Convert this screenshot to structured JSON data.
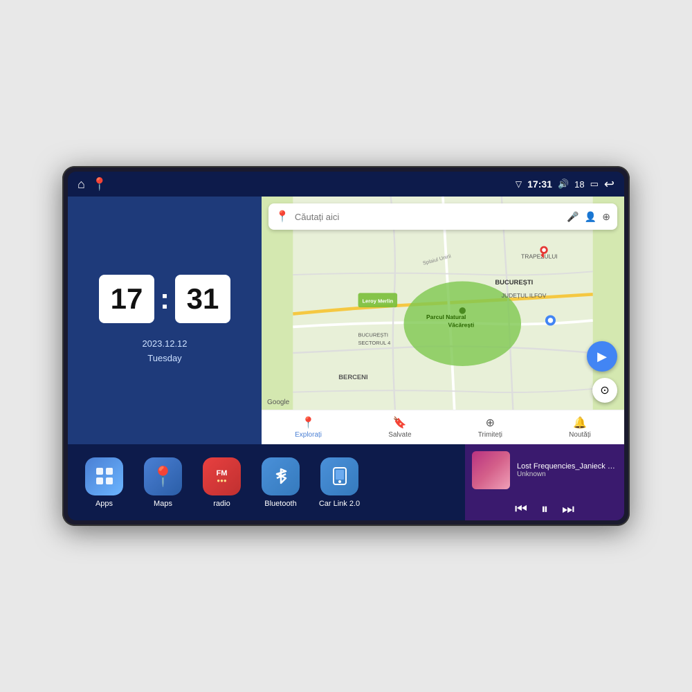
{
  "status_bar": {
    "time": "17:31",
    "signal": "▼",
    "volume": "🔊",
    "battery": "18",
    "battery_icon": "🔋",
    "back_icon": "↩",
    "home_icon": "⌂",
    "maps_icon": "📍"
  },
  "clock": {
    "hour": "17",
    "minute": "31",
    "date": "2023.12.12",
    "day": "Tuesday"
  },
  "apps": [
    {
      "label": "Apps",
      "icon_class": "icon-apps",
      "icon": "⊞"
    },
    {
      "label": "Maps",
      "icon_class": "icon-maps",
      "icon": "📍"
    },
    {
      "label": "radio",
      "icon_class": "icon-radio",
      "icon": "FM"
    },
    {
      "label": "Bluetooth",
      "icon_class": "icon-bluetooth",
      "icon": "⟨⟩"
    },
    {
      "label": "Car Link 2.0",
      "icon_class": "icon-carlink",
      "icon": "📱"
    }
  ],
  "music": {
    "title": "Lost Frequencies_Janieck Devy-...",
    "artist": "Unknown"
  },
  "map": {
    "search_placeholder": "Căutați aici",
    "tabs": [
      {
        "label": "Explorați",
        "active": true,
        "icon": "📍"
      },
      {
        "label": "Salvate",
        "active": false,
        "icon": "🔖"
      },
      {
        "label": "Trimiteți",
        "active": false,
        "icon": "⊕"
      },
      {
        "label": "Noutăți",
        "active": false,
        "icon": "🔔"
      }
    ],
    "park_label": "Parcul Natural Văcărești",
    "leroy_label": "Leroy Merlin",
    "berceni_label": "BERCENI",
    "bucuresti_label": "BUCUREȘTI",
    "ilfov_label": "JUDEȚUL ILFOV",
    "sector4_label": "BUCUREȘTI\nSECTORUL 4",
    "trapezului_label": "TRAPEZULUI",
    "splaiul_label": "Splaiul Unirii"
  }
}
